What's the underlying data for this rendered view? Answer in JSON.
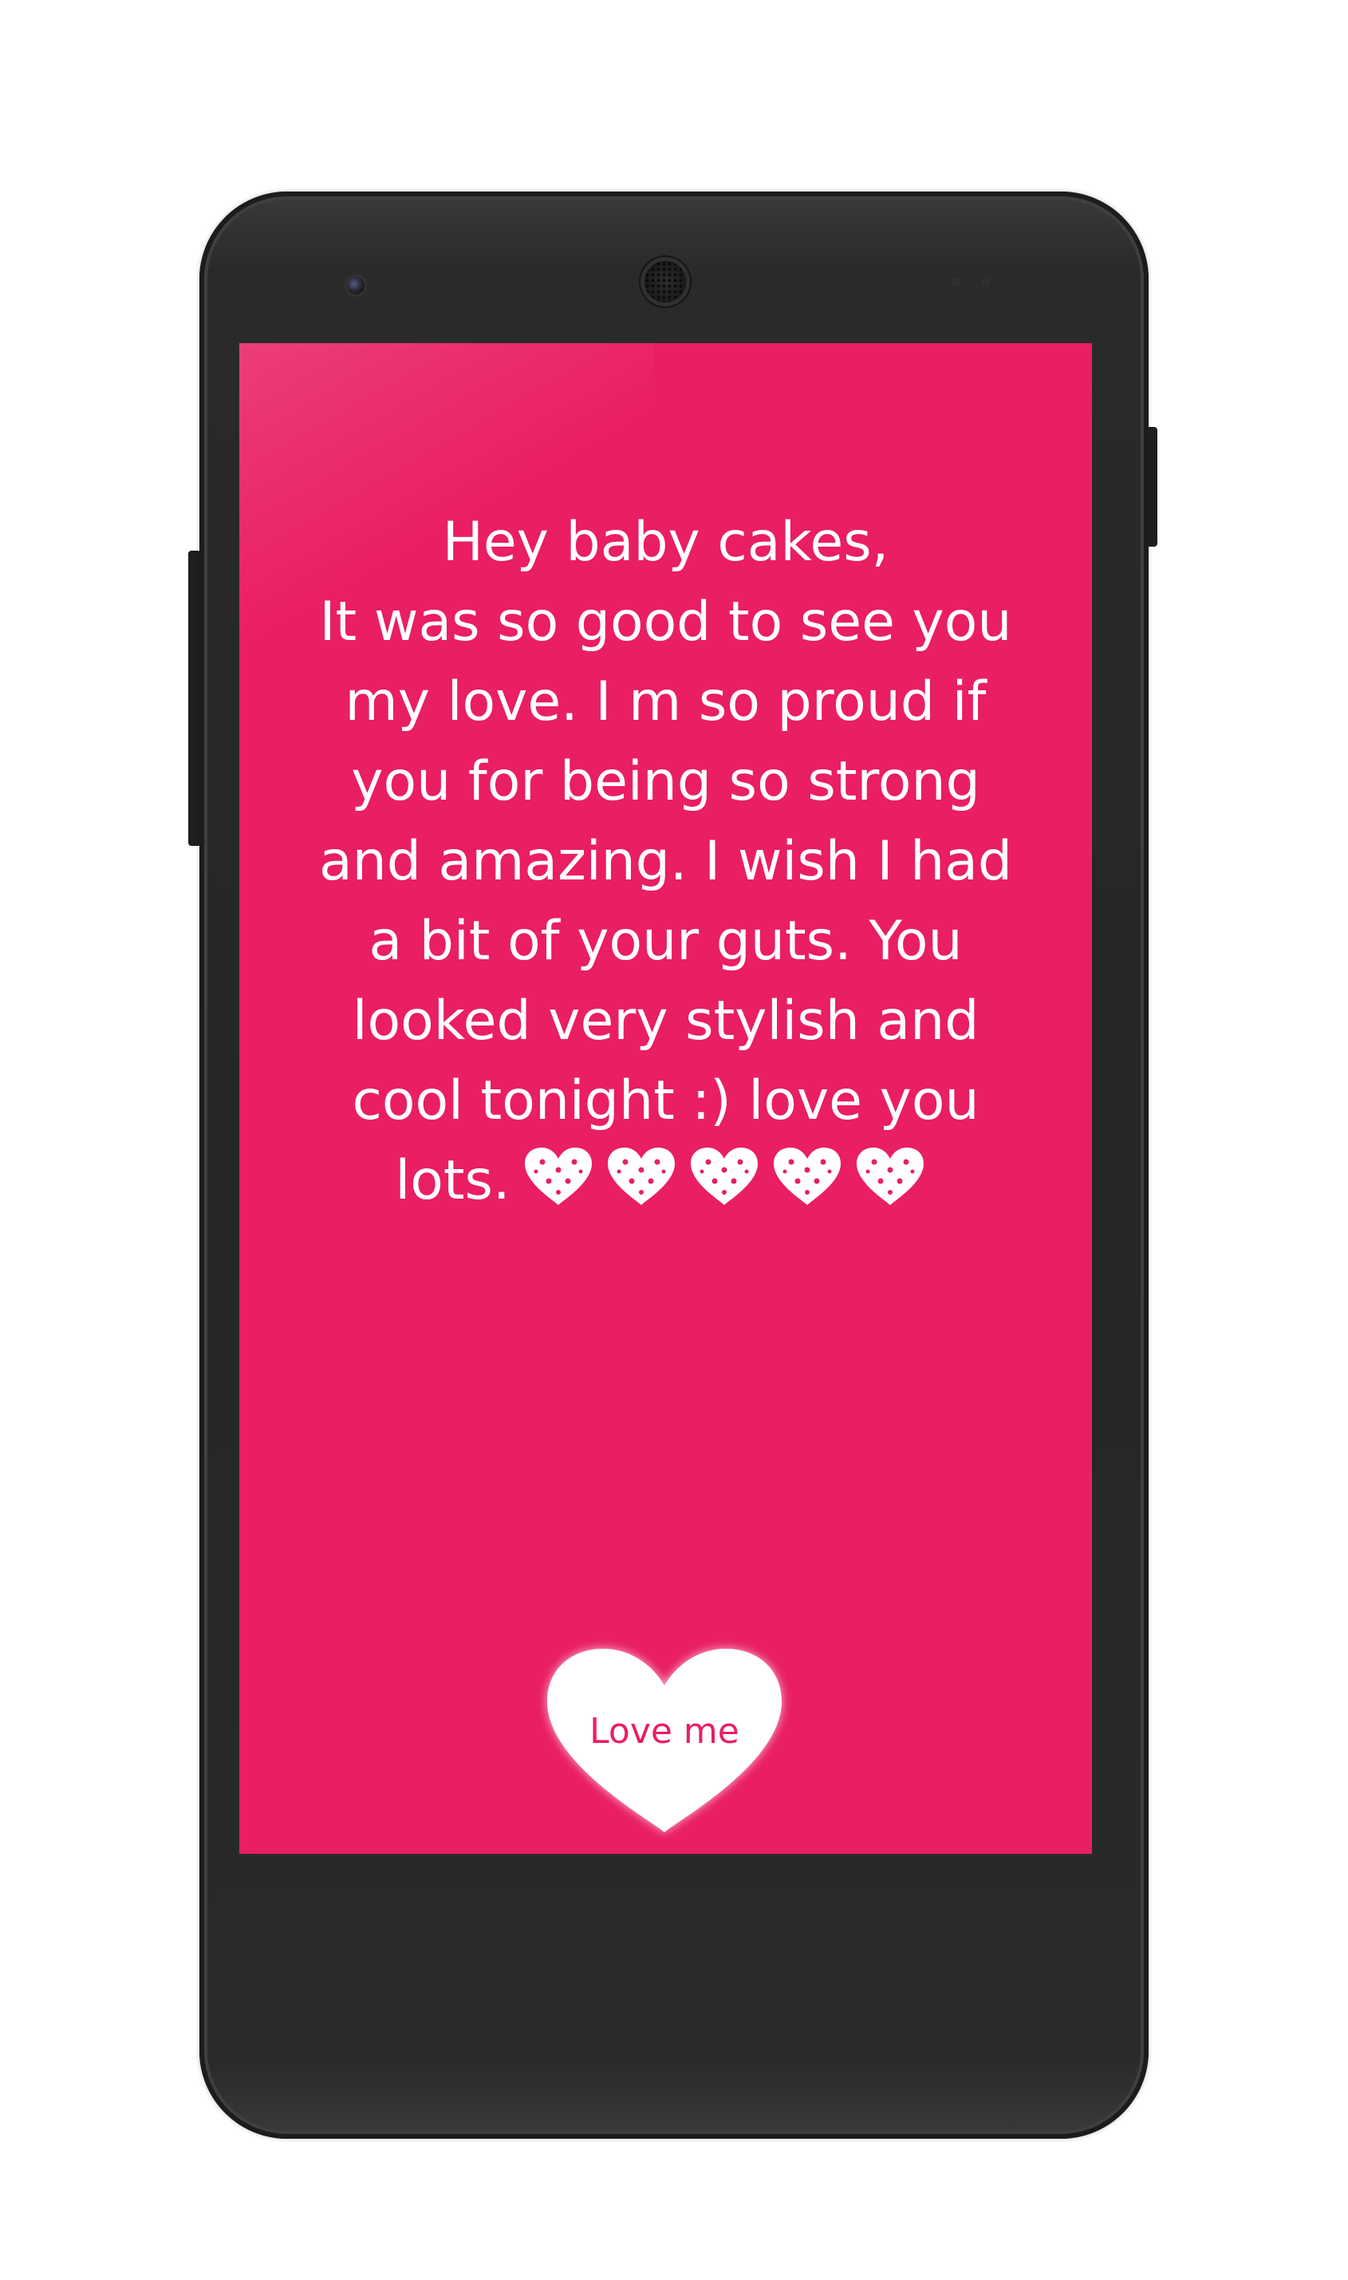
{
  "message": {
    "text": "Hey baby cakes,\nIt was so good to see you\nmy love. I m so proud if\nyou for being so strong\nand amazing. I wish I had\na bit of your guts. You\nlooked very stylish and\ncool tonight :) love you\nlots.",
    "trailing_icons": [
      "heart-icon",
      "heart-icon",
      "heart-icon",
      "heart-icon",
      "heart-icon"
    ]
  },
  "button": {
    "label": "Love me",
    "icon": "heart-icon"
  },
  "colors": {
    "screen_background": "#e91e63",
    "text": "#ffffff",
    "button_fill": "#ffffff",
    "button_text": "#e91e63"
  }
}
